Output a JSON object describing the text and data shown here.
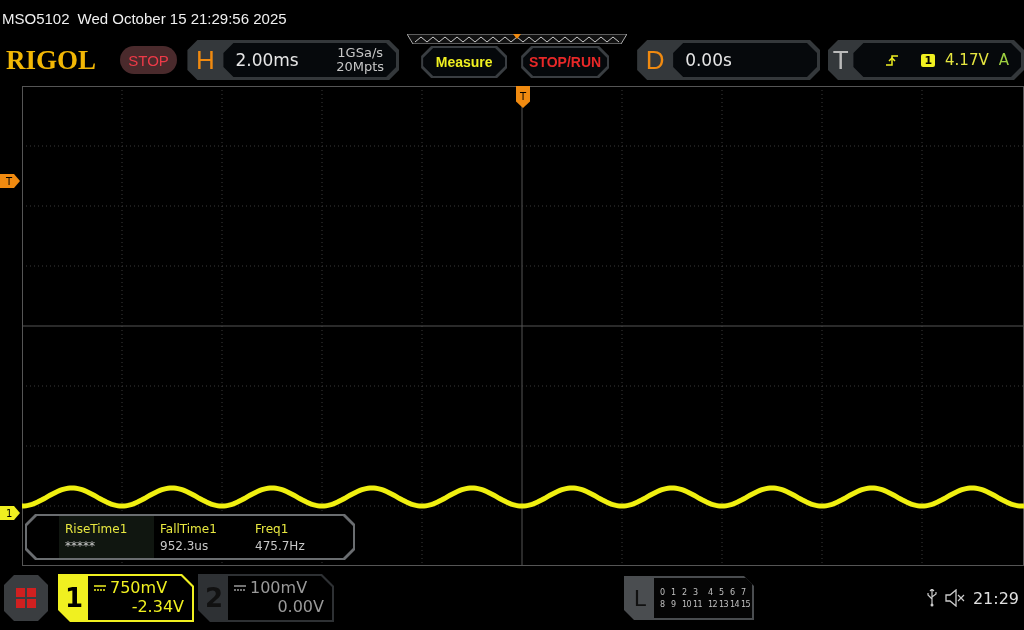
{
  "status_line": {
    "model": "MSO5102",
    "datetime": "Wed October 15 21:29:56 2025"
  },
  "toolbar": {
    "logo": "RIGOL",
    "run_state": "STOP",
    "horizontal": {
      "label": "H",
      "timebase": "2.00ms",
      "sample_rate": "1GSa/s",
      "memory_depth": "20Mpts"
    },
    "buttons": [
      {
        "label": "Measure",
        "kind": "measure"
      },
      {
        "label": "STOP/RUN",
        "kind": "stoprun"
      }
    ],
    "delay": {
      "label": "D",
      "value": "0.00s"
    },
    "trigger": {
      "label": "T",
      "source": "1",
      "level": "4.17V",
      "mode": "A"
    }
  },
  "graticule": {
    "trigger_position_marker": "T",
    "trigger_level_marker": "T",
    "channel_marker": "1"
  },
  "measurements": [
    {
      "name": "RiseTime1",
      "value": "*****"
    },
    {
      "name": "FallTime1",
      "value": "952.3us"
    },
    {
      "name": "Freq1",
      "value": "475.7Hz"
    }
  ],
  "channels": [
    {
      "number": "1",
      "scale": "750mV",
      "offset": "-2.34V",
      "selected": true
    },
    {
      "number": "2",
      "scale": "100mV",
      "offset": "0.00V",
      "selected": false
    }
  ],
  "logic": {
    "label": "L",
    "rows": [
      [
        "0",
        "1",
        "2",
        "3",
        "4",
        "5",
        "6",
        "7"
      ],
      [
        "8",
        "9",
        "10",
        "11",
        "12",
        "13",
        "14",
        "15"
      ]
    ]
  },
  "status": {
    "time": "21:29"
  }
}
